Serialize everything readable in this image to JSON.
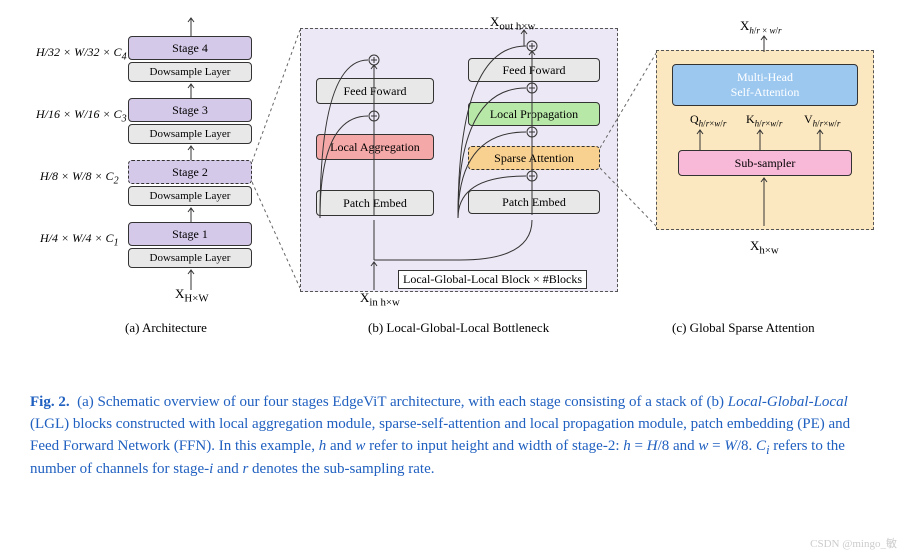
{
  "arch": {
    "stages": [
      "Stage 4",
      "Stage 3",
      "Stage 2",
      "Stage 1"
    ],
    "ds": "Dowsample Layer",
    "dims": [
      "H/32 × W/32 × C₄",
      "H/16 × W/16 × C₃",
      "H/8 × W/8 × C₂",
      "H/4 × W/4 × C₁"
    ],
    "xin": "X",
    "xin_sub": "H×W",
    "label": "(a) Architecture"
  },
  "bottleneck": {
    "left": [
      "Feed Foward",
      "Local Aggregation",
      "Patch Embed"
    ],
    "right": [
      "Feed Foward",
      "Local Propagation",
      "Sparse Attention",
      "Patch Embed"
    ],
    "xout": "X",
    "xout_sub": "out h×w",
    "xin": "X",
    "xin_sub": "in h×w",
    "footer": "Local-Global-Local Block × #Blocks",
    "label": "(b) Local-Global-Local Bottleneck"
  },
  "attn": {
    "mha1": "Multi-Head",
    "mha2": "Self-Attention",
    "q": "Q",
    "k": "K",
    "v": "V",
    "qkv_sub1": "h",
    "qkv_sub2": "w",
    "qkv_sub3": "r",
    "sub": "Sub-sampler",
    "xin": "X",
    "xin_sub": "h×w",
    "xout": "X",
    "xout_sub": "h/r × w/r",
    "label": "(c) Global Sparse Attention"
  },
  "caption": {
    "num": "Fig. 2.",
    "text": "(a) Schematic overview of our four stages EdgeViT architecture, with each stage consisting of a stack of (b) Local-Global-Local (LGL) blocks constructed with local aggregation module, sparse-self-attention and local propagation module, patch embedding (PE) and Feed Forward Network (FFN). In this example, h and w refer to input height and width of stage-2: h = H/8 and w = W/8. Cᵢ refers to the number of channels for stage-i and r denotes the sub-sampling rate."
  },
  "watermark": "CSDN @mingo_敏"
}
